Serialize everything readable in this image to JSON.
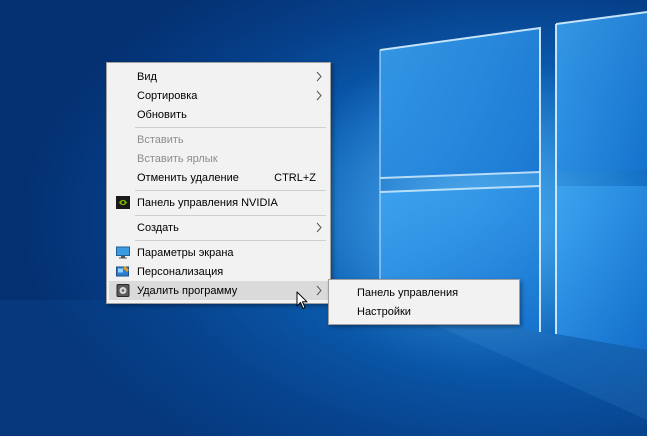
{
  "context_menu": {
    "items": [
      {
        "label": "Вид"
      },
      {
        "label": "Сортировка"
      },
      {
        "label": "Обновить"
      },
      {
        "label": "Вставить"
      },
      {
        "label": "Вставить ярлык"
      },
      {
        "label": "Отменить удаление",
        "shortcut": "CTRL+Z"
      },
      {
        "label": "Панель управления NVIDIA",
        "icon": "nvidia-icon"
      },
      {
        "label": "Создать"
      },
      {
        "label": "Параметры экрана",
        "icon": "display-icon"
      },
      {
        "label": "Персонализация",
        "icon": "personalization-icon"
      },
      {
        "label": "Удалить программу",
        "icon": "uninstall-icon"
      }
    ]
  },
  "submenu": {
    "items": [
      {
        "label": "Панель управления"
      },
      {
        "label": "Настройки"
      }
    ]
  },
  "colors": {
    "menu_background": "#f2f2f2",
    "highlight": "#dadada",
    "disabled_text": "#8d8d8d",
    "desktop_blue": "#0b5fb4"
  }
}
